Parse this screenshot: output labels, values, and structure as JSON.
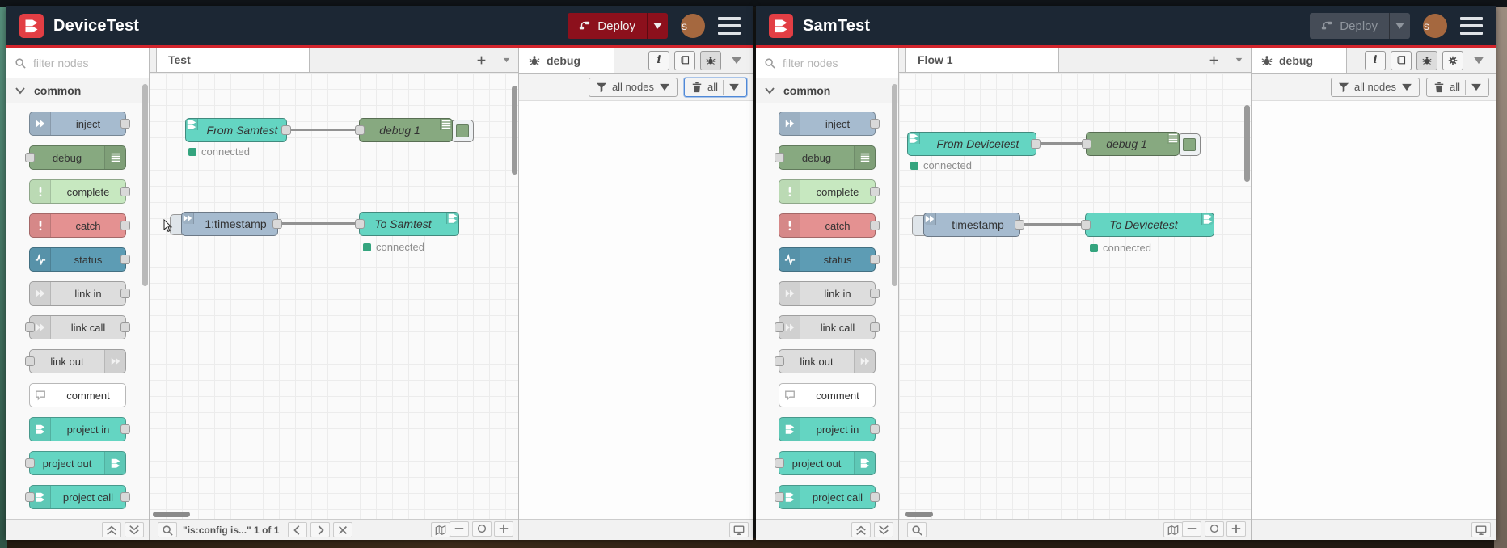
{
  "glyphs": {
    "info_button": "i"
  },
  "colors": {
    "header_bg": "#1c2734",
    "deploy_red": "#8C101C",
    "accent_red_line": "#d3242c",
    "connected_green": "#34a47e",
    "node_inject_blue": "#a6bbcf",
    "node_debug_green": "#87a980",
    "node_complete_green": "#c7e8c0",
    "node_catch_red": "#e49191",
    "node_status_blue": "#5d9cb4",
    "node_link_gray": "#dddddd",
    "node_project_teal": "#64d5c2"
  },
  "palette_items": [
    {
      "label": "inject",
      "type": "t-inject",
      "color": "#a6bbcf",
      "icon": "arrow-icon",
      "ports": "out",
      "iconSide": "left"
    },
    {
      "label": "debug",
      "type": "t-debug",
      "color": "#87a980",
      "icon": "lines-icon",
      "ports": "in",
      "iconSide": "right"
    },
    {
      "label": "complete",
      "type": "t-complete",
      "color": "#c7e8c0",
      "icon": "exclaim-icon",
      "ports": "out",
      "iconSide": "left"
    },
    {
      "label": "catch",
      "type": "t-catch",
      "color": "#e49191",
      "icon": "exclaim-icon",
      "ports": "out",
      "iconSide": "left"
    },
    {
      "label": "status",
      "type": "t-status",
      "color": "#5d9cb4",
      "icon": "pulse-icon",
      "ports": "out",
      "iconSide": "left"
    },
    {
      "label": "link in",
      "type": "t-link-in",
      "color": "#dddddd",
      "icon": "link-icon",
      "ports": "out",
      "iconSide": "left"
    },
    {
      "label": "link call",
      "type": "t-link-call",
      "color": "#dddddd",
      "icon": "link-icon",
      "ports": "both",
      "iconSide": "left"
    },
    {
      "label": "link out",
      "type": "t-link-out",
      "color": "#dddddd",
      "icon": "link-icon",
      "ports": "in",
      "iconSide": "right"
    },
    {
      "label": "comment",
      "type": "t-comment",
      "color": "#ffffff",
      "icon": "comment-icon",
      "ports": "none",
      "iconSide": "left"
    },
    {
      "label": "project in",
      "type": "t-project-in",
      "color": "#64d5c2",
      "icon": "project-icon",
      "ports": "out",
      "iconSide": "left"
    },
    {
      "label": "project out",
      "type": "t-project-out",
      "color": "#64d5c2",
      "icon": "project-icon",
      "ports": "in",
      "iconSide": "right"
    },
    {
      "label": "project call",
      "type": "t-project-call",
      "color": "#64d5c2",
      "icon": "project-icon",
      "ports": "both",
      "iconSide": "left"
    }
  ],
  "windows": [
    {
      "title": "DeviceTest",
      "deploy": {
        "label": "Deploy",
        "disabled": false
      },
      "user_initial": "s",
      "palette": {
        "filter_placeholder": "filter nodes",
        "category": "common"
      },
      "workspace": {
        "tab": "Test",
        "connected": "connected",
        "nodes": {
          "from": {
            "label": "From Samtest"
          },
          "debug": {
            "label": "debug 1"
          },
          "inject": {
            "label": "1:timestamp"
          },
          "to": {
            "label": "To Samtest"
          }
        }
      },
      "debug_panel": {
        "tab": "debug",
        "filter_nodes": "all nodes",
        "clear_all": "all"
      },
      "footer": {
        "search_result": "\"is:config is...\" 1 of 1"
      }
    },
    {
      "title": "SamTest",
      "deploy": {
        "label": "Deploy",
        "disabled": true
      },
      "user_initial": "s",
      "palette": {
        "filter_placeholder": "filter nodes",
        "category": "common"
      },
      "workspace": {
        "tab": "Flow 1",
        "connected": "connected",
        "nodes": {
          "from": {
            "label": "From Devicetest"
          },
          "debug": {
            "label": "debug 1"
          },
          "inject": {
            "label": "timestamp"
          },
          "to": {
            "label": "To Devicetest"
          }
        }
      },
      "debug_panel": {
        "tab": "debug",
        "filter_nodes": "all nodes",
        "clear_all": "all"
      }
    }
  ]
}
